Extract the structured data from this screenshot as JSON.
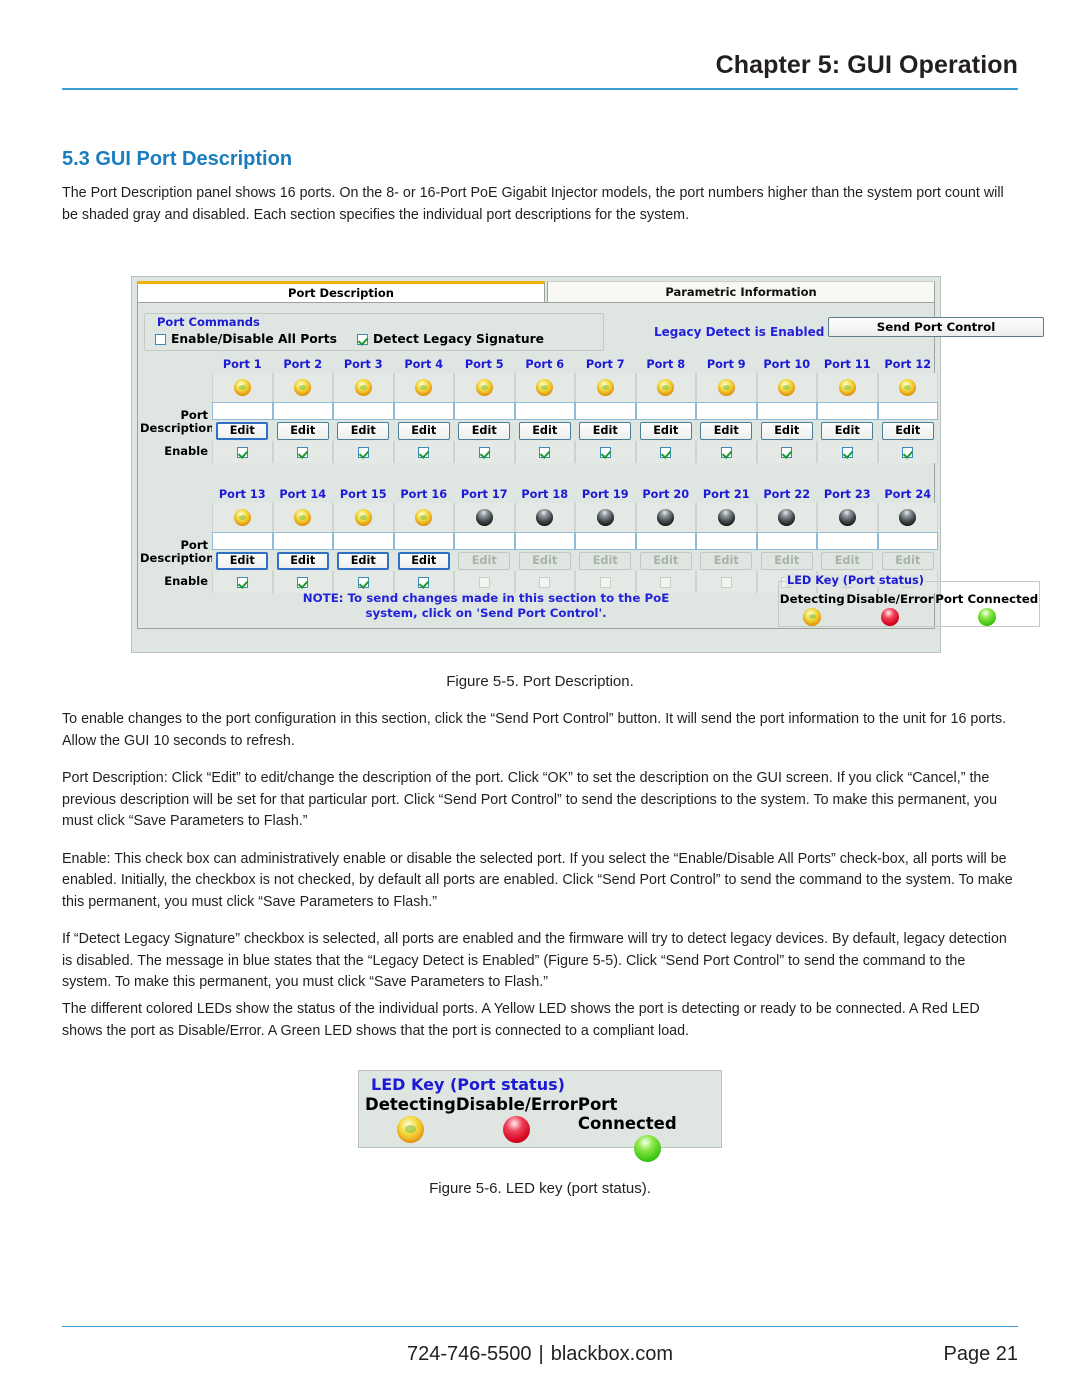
{
  "header": {
    "chapter_title": "Chapter 5: GUI Operation"
  },
  "section": {
    "heading": "5.3 GUI Port Description",
    "intro_paragraph": "The Port Description panel shows 16 ports. On the 8- or 16-Port PoE Gigabit Injector models, the port numbers higher than the system port count will be shaded gray and disabled. Each section specifies the individual port descriptions for the system."
  },
  "figure_5_5": {
    "caption": "Figure 5-5. Port Description.",
    "tabs": [
      {
        "label": "Port Description",
        "active": true
      },
      {
        "label": "Parametric Information",
        "active": false
      }
    ],
    "port_commands": {
      "group_title": "Port Commands",
      "enable_all_label": "Enable/Disable All Ports",
      "enable_all_checked": false,
      "detect_legacy_label": "Detect Legacy Signature",
      "detect_legacy_checked": true,
      "legacy_message": "Legacy Detect is Enabled",
      "send_button_label": "Send Port Control"
    },
    "row_labels": {
      "port_description_line1": "Port",
      "port_description_line2": "Description",
      "enable": "Enable"
    },
    "edit_button_label": "Edit",
    "ports_row1": [
      {
        "name": "Port 1",
        "led": "yellow",
        "edit_enabled": true,
        "edit_focus": true,
        "enabled": true,
        "description": ""
      },
      {
        "name": "Port 2",
        "led": "yellow",
        "edit_enabled": true,
        "edit_focus": false,
        "enabled": true,
        "description": ""
      },
      {
        "name": "Port 3",
        "led": "yellow",
        "edit_enabled": true,
        "edit_focus": false,
        "enabled": true,
        "description": ""
      },
      {
        "name": "Port 4",
        "led": "yellow",
        "edit_enabled": true,
        "edit_focus": false,
        "enabled": true,
        "description": ""
      },
      {
        "name": "Port 5",
        "led": "yellow",
        "edit_enabled": true,
        "edit_focus": false,
        "enabled": true,
        "description": ""
      },
      {
        "name": "Port 6",
        "led": "yellow",
        "edit_enabled": true,
        "edit_focus": false,
        "enabled": true,
        "description": ""
      },
      {
        "name": "Port 7",
        "led": "yellow",
        "edit_enabled": true,
        "edit_focus": false,
        "enabled": true,
        "description": ""
      },
      {
        "name": "Port 8",
        "led": "yellow",
        "edit_enabled": true,
        "edit_focus": false,
        "enabled": true,
        "description": ""
      },
      {
        "name": "Port 9",
        "led": "yellow",
        "edit_enabled": true,
        "edit_focus": false,
        "enabled": true,
        "description": ""
      },
      {
        "name": "Port 10",
        "led": "yellow",
        "edit_enabled": true,
        "edit_focus": false,
        "enabled": true,
        "description": ""
      },
      {
        "name": "Port 11",
        "led": "yellow",
        "edit_enabled": true,
        "edit_focus": false,
        "enabled": true,
        "description": ""
      },
      {
        "name": "Port 12",
        "led": "yellow",
        "edit_enabled": true,
        "edit_focus": false,
        "enabled": true,
        "description": ""
      }
    ],
    "ports_row2": [
      {
        "name": "Port 13",
        "led": "yellow",
        "edit_enabled": true,
        "edit_focus": true,
        "enabled": true,
        "description": ""
      },
      {
        "name": "Port 14",
        "led": "yellow",
        "edit_enabled": true,
        "edit_focus": true,
        "enabled": true,
        "description": ""
      },
      {
        "name": "Port 15",
        "led": "yellow",
        "edit_enabled": true,
        "edit_focus": true,
        "enabled": true,
        "description": ""
      },
      {
        "name": "Port 16",
        "led": "yellow",
        "edit_enabled": true,
        "edit_focus": true,
        "enabled": true,
        "description": ""
      },
      {
        "name": "Port 17",
        "led": "black",
        "edit_enabled": false,
        "edit_focus": false,
        "enabled": false,
        "description": ""
      },
      {
        "name": "Port 18",
        "led": "black",
        "edit_enabled": false,
        "edit_focus": false,
        "enabled": false,
        "description": ""
      },
      {
        "name": "Port 19",
        "led": "black",
        "edit_enabled": false,
        "edit_focus": false,
        "enabled": false,
        "description": ""
      },
      {
        "name": "Port 20",
        "led": "black",
        "edit_enabled": false,
        "edit_focus": false,
        "enabled": false,
        "description": ""
      },
      {
        "name": "Port 21",
        "led": "black",
        "edit_enabled": false,
        "edit_focus": false,
        "enabled": false,
        "description": ""
      },
      {
        "name": "Port 22",
        "led": "black",
        "edit_enabled": false,
        "edit_focus": false,
        "enabled": false,
        "description": ""
      },
      {
        "name": "Port 23",
        "led": "black",
        "edit_enabled": false,
        "edit_focus": false,
        "enabled": false,
        "description": ""
      },
      {
        "name": "Port 24",
        "led": "black",
        "edit_enabled": false,
        "edit_focus": false,
        "enabled": false,
        "description": ""
      }
    ],
    "note_line1": "NOTE: To send changes made in this section to the PoE",
    "note_line2": "system, click on 'Send Port Control'.",
    "led_key": {
      "title": "LED Key (Port status)",
      "items": [
        {
          "label": "Detecting",
          "color": "yellow"
        },
        {
          "label": "Disable/Error",
          "color": "red"
        },
        {
          "label": "Port Connected",
          "color": "green"
        }
      ]
    }
  },
  "paragraphs_after_figure": [
    "To enable changes to the port configuration in this section, click the “Send Port Control” button. It will send the port information to the unit for 16 ports. Allow the GUI 10 seconds to refresh.",
    "Port Description: Click “Edit” to edit/change the description of the port. Click “OK” to set the description on the GUI screen. If you click “Cancel,” the previous description will be set for that particular port. Click “Send Port Control” to send the descriptions to the system. To make this permanent, you must click “Save Parameters to Flash.”",
    "Enable: This check box can administratively enable or disable the selected port. If you select the “Enable/Disable All Ports” check-box, all ports will be enabled. Initially, the checkbox is not checked, by default all ports are enabled. Click “Send Port Control” to send the command to the system. To make this permanent, you must click “Save Parameters to Flash.”",
    "If “Detect Legacy Signature” checkbox is selected, all ports are enabled and the firmware will try to detect legacy devices. By default, legacy detection is disabled. The message in blue states that the “Legacy Detect is Enabled” (Figure 5-5). Click “Send Port Control” to send the command to the system. To make this permanent, you must click “Save Parameters to Flash.”"
  ],
  "led_paragraph": "The different colored LEDs show the status of the individual ports. A Yellow LED shows the port is detecting or ready to be connected. A Red LED shows the port as Disable/Error. A Green LED shows that the port is connected to a compliant load.",
  "figure_5_6": {
    "caption": "Figure 5-6. LED key (port status).",
    "title": "LED Key (Port status)",
    "items": [
      {
        "label": "Detecting",
        "color": "yellow"
      },
      {
        "label": "Disable/Error",
        "color": "red"
      },
      {
        "label": "Port Connected",
        "color": "green"
      }
    ]
  },
  "footer": {
    "phone": "724-746-5500",
    "separator": "|",
    "website": "blackbox.com",
    "page": "Page 21"
  },
  "colors": {
    "accent_blue": "#3d9fd1",
    "heading_blue": "#1a7dc0",
    "gui_label_blue": "#1b1bd6",
    "tab_active_top": "#f0b20b",
    "led_yellow": "#f0a81e",
    "led_red": "#d3001a",
    "led_green": "#3ec412",
    "led_black": "#3c4245"
  }
}
